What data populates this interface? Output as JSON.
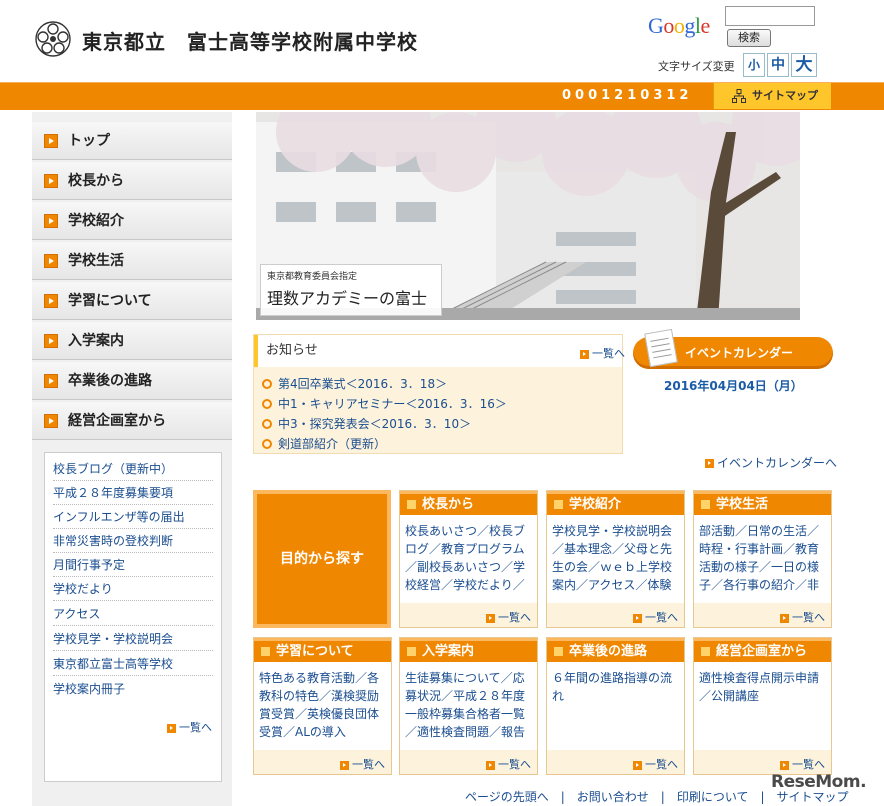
{
  "header": {
    "school_name": "東京都立　富士高等学校附属中学校",
    "google_logo": "Google",
    "search_button": "検索",
    "font_size_label": "文字サイズ変更",
    "font_small": "小",
    "font_medium": "中",
    "font_large": "大",
    "counter": "0001210312",
    "sitemap": "サイトマップ"
  },
  "sidebar": {
    "nav": [
      {
        "label": "トップ"
      },
      {
        "label": "校長から"
      },
      {
        "label": "学校紹介"
      },
      {
        "label": "学校生活"
      },
      {
        "label": "学習について"
      },
      {
        "label": "入学案内"
      },
      {
        "label": "卒業後の進路"
      },
      {
        "label": "経営企画室から"
      }
    ],
    "links": [
      {
        "label": "校長ブログ（更新中）"
      },
      {
        "label": "平成２８年度募集要項"
      },
      {
        "label": "インフルエンザ等の届出"
      },
      {
        "label": "非常災害時の登校判断"
      },
      {
        "label": "月間行事予定"
      },
      {
        "label": "学校だより"
      },
      {
        "label": "アクセス"
      },
      {
        "label": "学校見学・学校説明会"
      },
      {
        "label": "東京都立富士高等学校"
      },
      {
        "label": "学校案内冊子"
      }
    ],
    "more": "一覧へ"
  },
  "hero": {
    "caption_small": "東京都教育委員会指定",
    "caption_big": "理数アカデミーの富士"
  },
  "news": {
    "title": "お知らせ",
    "more": "一覧へ",
    "items": [
      {
        "label": "第4回卒業式＜2016．3．18＞"
      },
      {
        "label": "中1・キャリアセミナー＜2016．3．16＞"
      },
      {
        "label": "中3・探究発表会＜2016．3．10＞"
      },
      {
        "label": "剣道部紹介（更新）"
      }
    ]
  },
  "event": {
    "button": "イベントカレンダー",
    "date": "2016年04月04日（月）",
    "more": "イベントカレンダーへ"
  },
  "purpose_button": "目的から探す",
  "cards": [
    {
      "title": "校長から",
      "body": "校長あいさつ／校長ブログ／教育プログラム／副校長あいさつ／学校経営／学校だより／",
      "more": "一覧へ"
    },
    {
      "title": "学校紹介",
      "body": "学校見学・学校説明会／基本理念／父母と先生の会／ｗｅｂ上学校案内／アクセス／体験",
      "more": "一覧へ"
    },
    {
      "title": "学校生活",
      "body": "部活動／日常の生活／時程・行事計画／教育活動の様子／一日の様子／各行事の紹介／非",
      "more": "一覧へ"
    },
    {
      "title": "学習について",
      "body": "特色ある教育活動／各教科の特色／漢検奨励賞受賞／英検優良団体受賞／ALの導入",
      "more": "一覧へ"
    },
    {
      "title": "入学案内",
      "body": "生徒募集について／応募状況／平成２８年度一般枠募集合格者一覧／適性検査問題／報告",
      "more": "一覧へ"
    },
    {
      "title": "卒業後の進路",
      "body": "６年間の進路指導の流れ",
      "more": "一覧へ"
    },
    {
      "title": "経営企画室から",
      "body": "適性検査得点開示申請／公開講座",
      "more": "一覧へ"
    }
  ],
  "footer": {
    "links": "ページの先頭へ　|　お問い合わせ　|　印刷について　|　サイトマップ"
  },
  "watermark": "ReseMom.",
  "colors": {
    "accent": "#f08700",
    "highlight": "#ffc62c",
    "link": "#1a4d8f"
  }
}
